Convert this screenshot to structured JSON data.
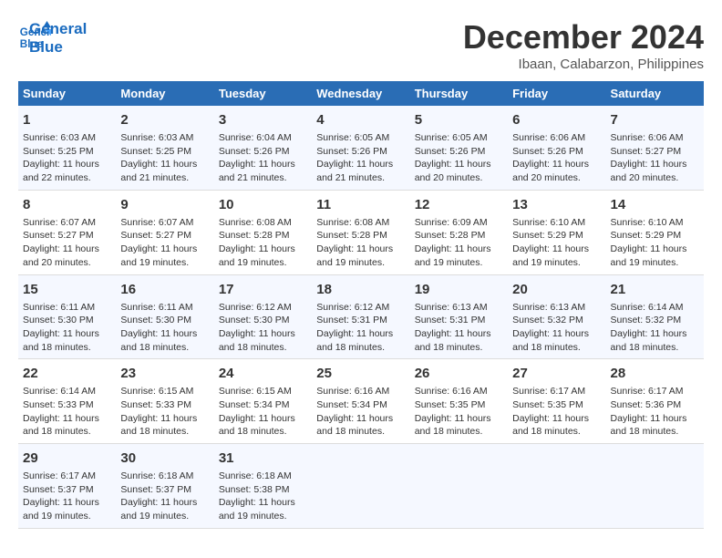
{
  "logo": {
    "line1": "General",
    "line2": "Blue"
  },
  "title": "December 2024",
  "location": "Ibaan, Calabarzon, Philippines",
  "weekdays": [
    "Sunday",
    "Monday",
    "Tuesday",
    "Wednesday",
    "Thursday",
    "Friday",
    "Saturday"
  ],
  "weeks": [
    [
      {
        "day": "1",
        "info": "Sunrise: 6:03 AM\nSunset: 5:25 PM\nDaylight: 11 hours\nand 22 minutes."
      },
      {
        "day": "2",
        "info": "Sunrise: 6:03 AM\nSunset: 5:25 PM\nDaylight: 11 hours\nand 21 minutes."
      },
      {
        "day": "3",
        "info": "Sunrise: 6:04 AM\nSunset: 5:26 PM\nDaylight: 11 hours\nand 21 minutes."
      },
      {
        "day": "4",
        "info": "Sunrise: 6:05 AM\nSunset: 5:26 PM\nDaylight: 11 hours\nand 21 minutes."
      },
      {
        "day": "5",
        "info": "Sunrise: 6:05 AM\nSunset: 5:26 PM\nDaylight: 11 hours\nand 20 minutes."
      },
      {
        "day": "6",
        "info": "Sunrise: 6:06 AM\nSunset: 5:26 PM\nDaylight: 11 hours\nand 20 minutes."
      },
      {
        "day": "7",
        "info": "Sunrise: 6:06 AM\nSunset: 5:27 PM\nDaylight: 11 hours\nand 20 minutes."
      }
    ],
    [
      {
        "day": "8",
        "info": "Sunrise: 6:07 AM\nSunset: 5:27 PM\nDaylight: 11 hours\nand 20 minutes."
      },
      {
        "day": "9",
        "info": "Sunrise: 6:07 AM\nSunset: 5:27 PM\nDaylight: 11 hours\nand 19 minutes."
      },
      {
        "day": "10",
        "info": "Sunrise: 6:08 AM\nSunset: 5:28 PM\nDaylight: 11 hours\nand 19 minutes."
      },
      {
        "day": "11",
        "info": "Sunrise: 6:08 AM\nSunset: 5:28 PM\nDaylight: 11 hours\nand 19 minutes."
      },
      {
        "day": "12",
        "info": "Sunrise: 6:09 AM\nSunset: 5:28 PM\nDaylight: 11 hours\nand 19 minutes."
      },
      {
        "day": "13",
        "info": "Sunrise: 6:10 AM\nSunset: 5:29 PM\nDaylight: 11 hours\nand 19 minutes."
      },
      {
        "day": "14",
        "info": "Sunrise: 6:10 AM\nSunset: 5:29 PM\nDaylight: 11 hours\nand 19 minutes."
      }
    ],
    [
      {
        "day": "15",
        "info": "Sunrise: 6:11 AM\nSunset: 5:30 PM\nDaylight: 11 hours\nand 18 minutes."
      },
      {
        "day": "16",
        "info": "Sunrise: 6:11 AM\nSunset: 5:30 PM\nDaylight: 11 hours\nand 18 minutes."
      },
      {
        "day": "17",
        "info": "Sunrise: 6:12 AM\nSunset: 5:30 PM\nDaylight: 11 hours\nand 18 minutes."
      },
      {
        "day": "18",
        "info": "Sunrise: 6:12 AM\nSunset: 5:31 PM\nDaylight: 11 hours\nand 18 minutes."
      },
      {
        "day": "19",
        "info": "Sunrise: 6:13 AM\nSunset: 5:31 PM\nDaylight: 11 hours\nand 18 minutes."
      },
      {
        "day": "20",
        "info": "Sunrise: 6:13 AM\nSunset: 5:32 PM\nDaylight: 11 hours\nand 18 minutes."
      },
      {
        "day": "21",
        "info": "Sunrise: 6:14 AM\nSunset: 5:32 PM\nDaylight: 11 hours\nand 18 minutes."
      }
    ],
    [
      {
        "day": "22",
        "info": "Sunrise: 6:14 AM\nSunset: 5:33 PM\nDaylight: 11 hours\nand 18 minutes."
      },
      {
        "day": "23",
        "info": "Sunrise: 6:15 AM\nSunset: 5:33 PM\nDaylight: 11 hours\nand 18 minutes."
      },
      {
        "day": "24",
        "info": "Sunrise: 6:15 AM\nSunset: 5:34 PM\nDaylight: 11 hours\nand 18 minutes."
      },
      {
        "day": "25",
        "info": "Sunrise: 6:16 AM\nSunset: 5:34 PM\nDaylight: 11 hours\nand 18 minutes."
      },
      {
        "day": "26",
        "info": "Sunrise: 6:16 AM\nSunset: 5:35 PM\nDaylight: 11 hours\nand 18 minutes."
      },
      {
        "day": "27",
        "info": "Sunrise: 6:17 AM\nSunset: 5:35 PM\nDaylight: 11 hours\nand 18 minutes."
      },
      {
        "day": "28",
        "info": "Sunrise: 6:17 AM\nSunset: 5:36 PM\nDaylight: 11 hours\nand 18 minutes."
      }
    ],
    [
      {
        "day": "29",
        "info": "Sunrise: 6:17 AM\nSunset: 5:37 PM\nDaylight: 11 hours\nand 19 minutes."
      },
      {
        "day": "30",
        "info": "Sunrise: 6:18 AM\nSunset: 5:37 PM\nDaylight: 11 hours\nand 19 minutes."
      },
      {
        "day": "31",
        "info": "Sunrise: 6:18 AM\nSunset: 5:38 PM\nDaylight: 11 hours\nand 19 minutes."
      },
      {
        "day": "",
        "info": ""
      },
      {
        "day": "",
        "info": ""
      },
      {
        "day": "",
        "info": ""
      },
      {
        "day": "",
        "info": ""
      }
    ]
  ]
}
